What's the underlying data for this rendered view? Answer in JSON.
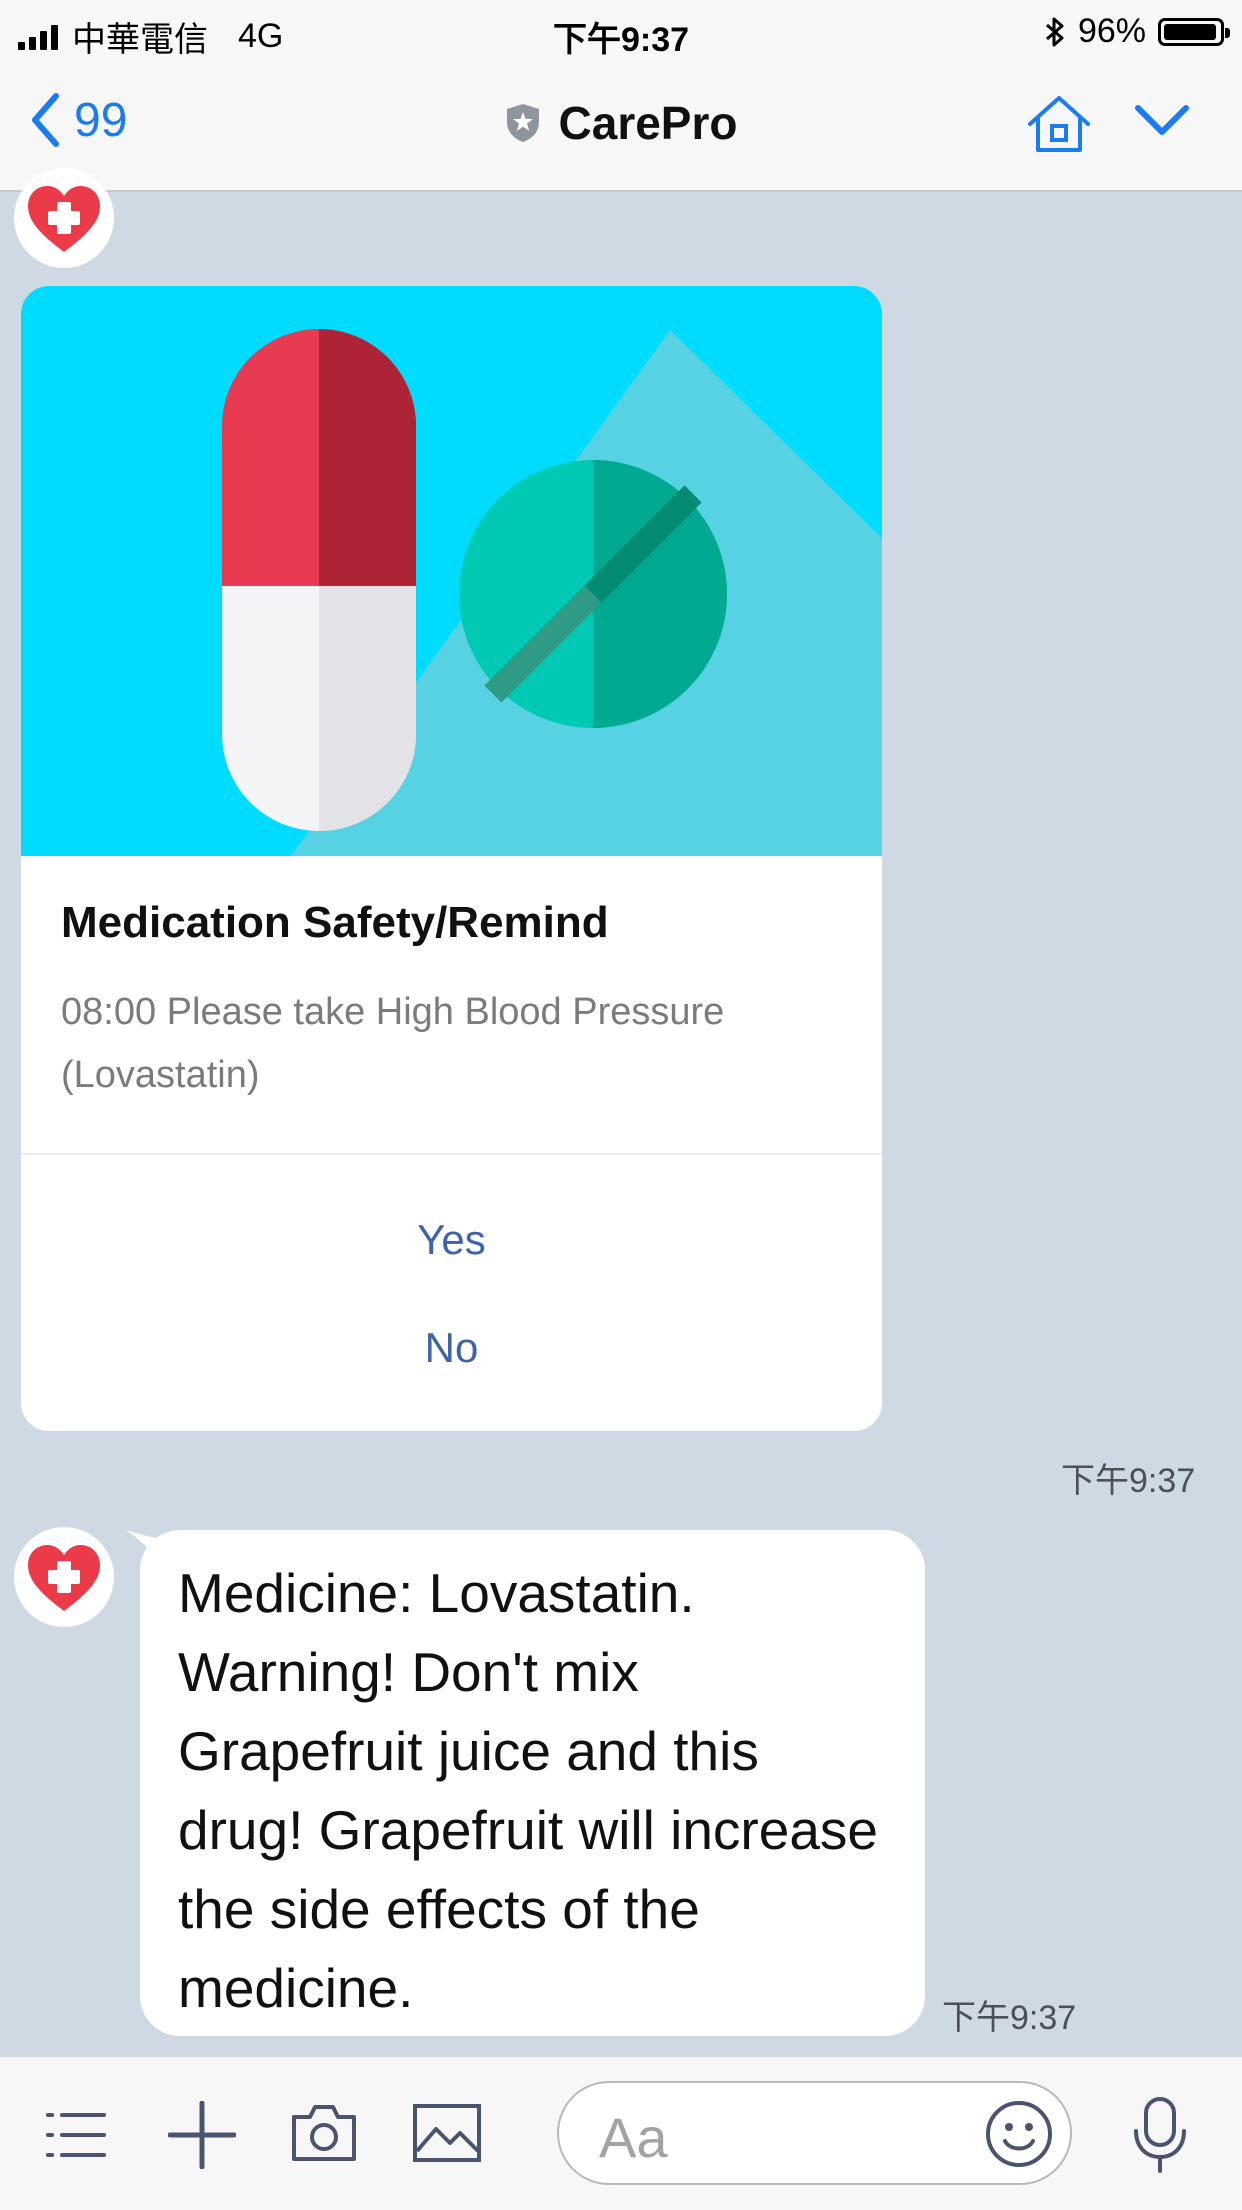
{
  "status_bar": {
    "carrier": "中華電信",
    "network": "4G",
    "time": "下午9:37",
    "battery": "96%",
    "battery_level": 0.96
  },
  "nav": {
    "back_count": "99",
    "title": "CarePro"
  },
  "card": {
    "title": "Medication Safety/Remind",
    "description": "08:00 Please take High Blood Pressure (Lovastatin)",
    "actions": [
      "Yes",
      "No"
    ],
    "timestamp": "下午9:37"
  },
  "message": {
    "text": "Medicine: Lovastatin. Warning! Don't mix Grapefruit juice and this drug! Grapefruit will increase the side effects of the medicine.",
    "timestamp": "下午9:37"
  },
  "input": {
    "placeholder": "Aa"
  },
  "colors": {
    "accent": "#1a7cf0",
    "chat_background": "#cfd9e4",
    "hero_background": "#00dcff",
    "action_text": "#3d64a8"
  },
  "icons": [
    "signal-icon",
    "bluetooth-icon",
    "battery-icon",
    "back-chevron-icon",
    "shield-icon",
    "home-icon",
    "chevron-down-icon",
    "menu-icon",
    "plus-icon",
    "camera-icon",
    "image-icon",
    "emoji-icon",
    "microphone-icon"
  ]
}
